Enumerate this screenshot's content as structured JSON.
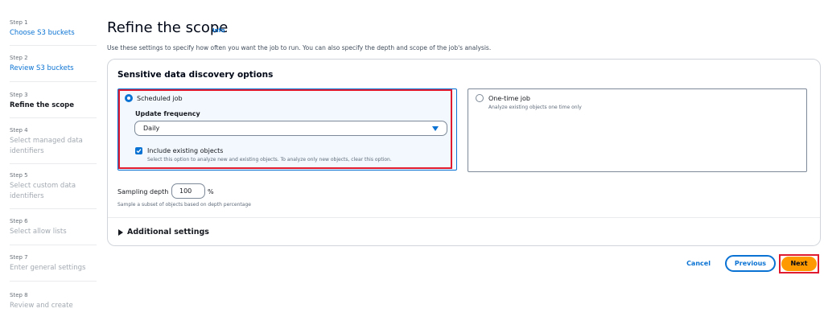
{
  "steps": [
    {
      "num": "Step 1",
      "label": "Choose S3 buckets",
      "state": "link"
    },
    {
      "num": "Step 2",
      "label": "Review S3 buckets",
      "state": "link"
    },
    {
      "num": "Step 3",
      "label": "Refine the scope",
      "state": "current"
    },
    {
      "num": "Step 4",
      "label": "Select managed data identifiers",
      "state": "disabled"
    },
    {
      "num": "Step 5",
      "label": "Select custom data identifiers",
      "state": "disabled"
    },
    {
      "num": "Step 6",
      "label": "Select allow lists",
      "state": "disabled"
    },
    {
      "num": "Step 7",
      "label": "Enter general settings",
      "state": "disabled"
    },
    {
      "num": "Step 8",
      "label": "Review and create",
      "state": "disabled"
    }
  ],
  "header": {
    "title": "Refine the scope",
    "info": "Info",
    "description": "Use these settings to specify how often you want the job to run. You can also specify the depth and scope of the job's analysis."
  },
  "discovery": {
    "title": "Sensitive data discovery options",
    "scheduled": {
      "label": "Scheduled job",
      "selected": true,
      "frequency_label": "Update frequency",
      "frequency_value": "Daily",
      "include_label": "Include existing objects",
      "include_checked": true,
      "include_desc": "Select this option to analyze new and existing objects. To analyze only new objects, clear this option."
    },
    "onetime": {
      "label": "One-time job",
      "selected": false,
      "desc": "Analyze existing objects one time only"
    }
  },
  "sampling": {
    "label": "Sampling depth",
    "value": "100",
    "unit": "%",
    "desc": "Sample a subset of objects based on depth percentage"
  },
  "additional_settings": "Additional settings",
  "footer": {
    "cancel": "Cancel",
    "previous": "Previous",
    "next": "Next"
  },
  "colors": {
    "link": "#0972d3",
    "primary_button": "#ff9900",
    "highlight": "#e01b2f"
  },
  "icons": [
    "radio-selected-icon",
    "radio-unselected-icon",
    "checkbox-checked-icon",
    "dropdown-caret-icon",
    "expand-caret-icon"
  ]
}
